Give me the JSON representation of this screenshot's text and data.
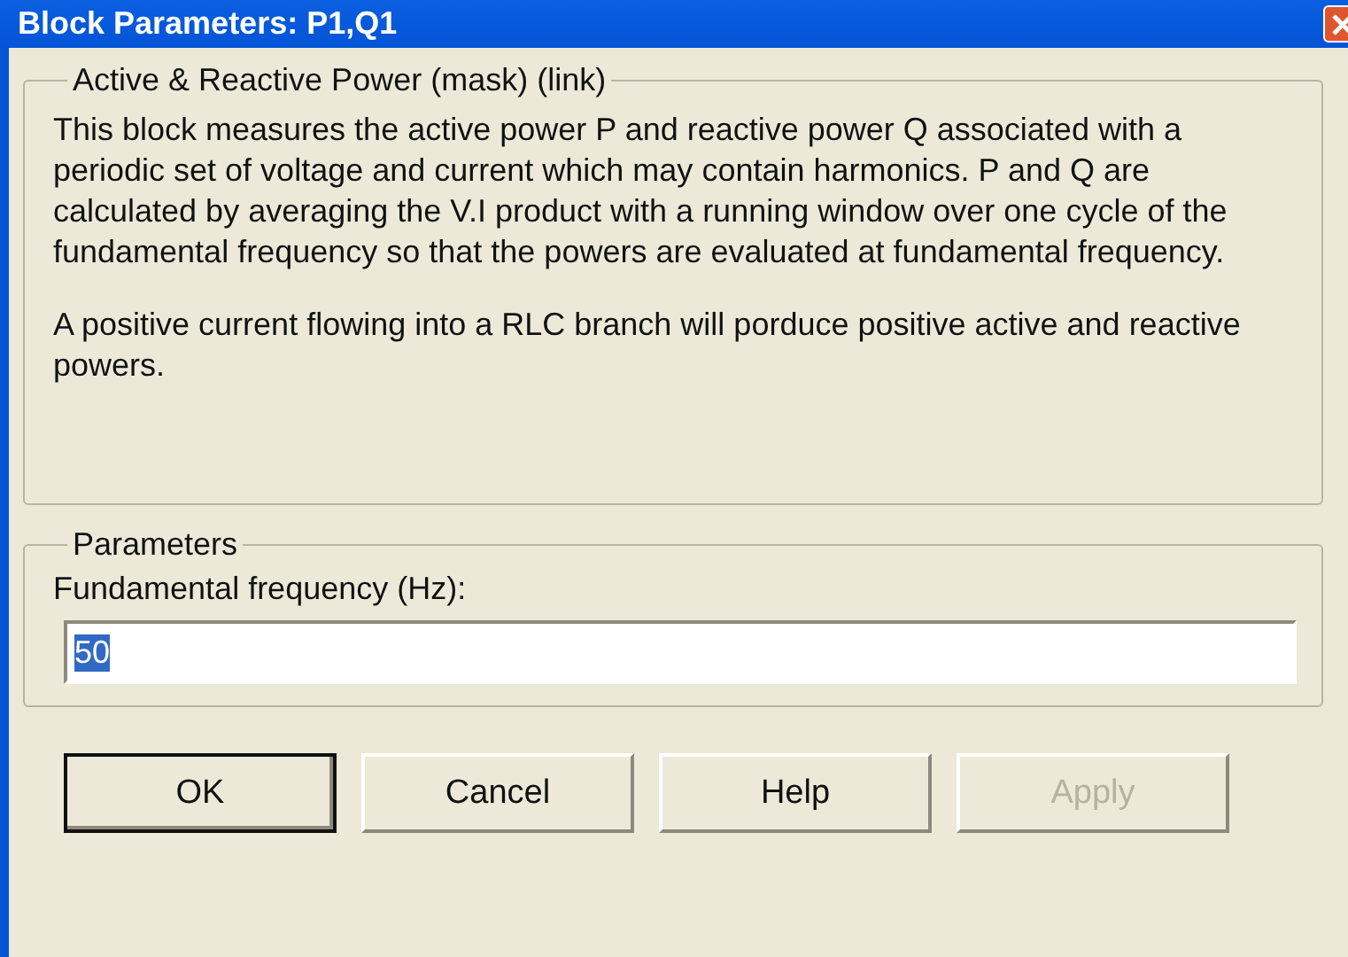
{
  "window": {
    "title": "Block Parameters: P1,Q1"
  },
  "description": {
    "title": "Active & Reactive Power  (mask) (link)",
    "paragraphs": [
      "This block measures the active power P and reactive power Q associated with a periodic  set of voltage and current which may contain harmonics. P and Q are calculated by averaging the V.I product with a running window over one cycle of the fundamental frequency so that the powers are evaluated at fundamental frequency.",
      "A positive current flowing into a RLC branch will porduce positive active and reactive powers."
    ]
  },
  "parameters": {
    "title": "Parameters",
    "fields": [
      {
        "label": "Fundamental frequency (Hz):",
        "value": "50",
        "selected": true
      }
    ]
  },
  "buttons": [
    {
      "label": "OK",
      "default": true,
      "disabled": false
    },
    {
      "label": "Cancel",
      "default": false,
      "disabled": false
    },
    {
      "label": "Help",
      "default": false,
      "disabled": false
    },
    {
      "label": "Apply",
      "default": false,
      "disabled": true
    }
  ]
}
